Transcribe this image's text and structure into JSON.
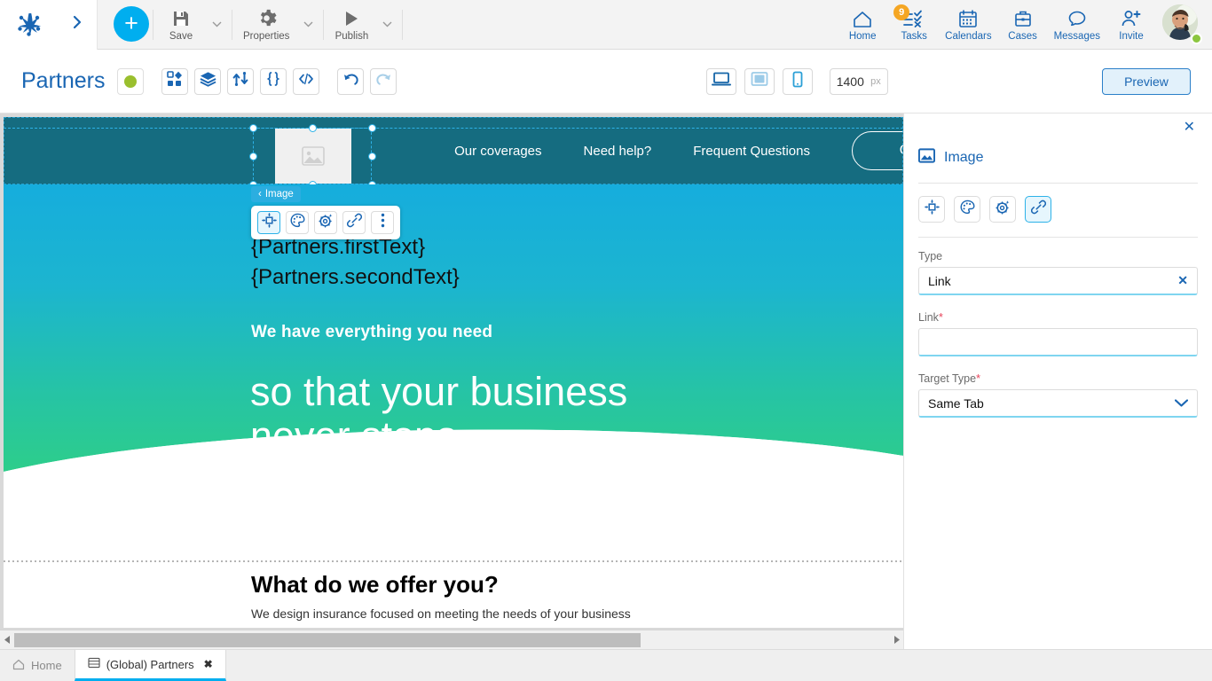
{
  "topbar": {
    "logo_icon": "anchor-logo-icon",
    "expand_icon": "chevron-right-icon",
    "add_button": "+",
    "tools": [
      {
        "label": "Save",
        "icon": "save-disk-icon"
      },
      {
        "label": "Properties",
        "icon": "gear-icon"
      },
      {
        "label": "Publish",
        "icon": "play-triangle-icon"
      }
    ],
    "nav": [
      {
        "label": "Home",
        "icon": "home-icon",
        "badge": ""
      },
      {
        "label": "Tasks",
        "icon": "tasks-checklist-icon",
        "badge": "9"
      },
      {
        "label": "Calendars",
        "icon": "calendar-icon",
        "badge": ""
      },
      {
        "label": "Cases",
        "icon": "briefcase-icon",
        "badge": ""
      },
      {
        "label": "Messages",
        "icon": "speech-bubble-icon",
        "badge": ""
      },
      {
        "label": "Invite",
        "icon": "person-add-icon",
        "badge": ""
      }
    ],
    "avatar_status_color": "#8CC63F"
  },
  "subbar": {
    "page_title": "Partners",
    "status_color": "#9ABF2E",
    "tools": [
      {
        "name": "components-icon"
      },
      {
        "name": "layers-icon"
      },
      {
        "name": "data-flow-icon"
      },
      {
        "name": "curly-braces-icon"
      },
      {
        "name": "code-tags-icon"
      }
    ],
    "history": [
      {
        "name": "undo-icon"
      },
      {
        "name": "redo-icon"
      }
    ],
    "devices": [
      {
        "name": "desktop-icon",
        "active": true
      },
      {
        "name": "tablet-icon",
        "active": false
      },
      {
        "name": "mobile-icon",
        "active": false
      }
    ],
    "width_value": "1400",
    "width_unit": "px",
    "preview_label": "Preview"
  },
  "canvas": {
    "site_nav": {
      "links": [
        "Our coverages",
        "Need help?",
        "Frequent Questions"
      ],
      "pill_label": "Q",
      "bg_color": "#156C80"
    },
    "hero": {
      "kicker": "We have everything you need",
      "title_line1": "so that your business",
      "title_line2": "never stops",
      "gradient_from": "#16ADDD",
      "gradient_to": "#2ECE89"
    },
    "body": {
      "token_line1": "{Partners.firstText}",
      "token_line2": "{Partners.secondText}",
      "offer_title": "What do we offer you?",
      "offer_sub": "We design insurance focused on meeting the needs of your business"
    },
    "selection": {
      "context_label": "Image",
      "back_chevron": "‹",
      "toolbar_buttons": [
        {
          "name": "move-resize-icon",
          "active": true
        },
        {
          "name": "palette-icon",
          "active": false
        },
        {
          "name": "gear-sparkle-icon",
          "active": false
        },
        {
          "name": "link-chain-icon",
          "active": false
        },
        {
          "name": "more-vertical-icon",
          "active": false
        }
      ]
    }
  },
  "panel": {
    "close_label": "✕",
    "title": "Image",
    "title_icon": "image-icon",
    "tabs": [
      {
        "name": "move-resize-icon",
        "active": false
      },
      {
        "name": "palette-icon",
        "active": false
      },
      {
        "name": "gear-sparkle-icon",
        "active": false
      },
      {
        "name": "link-chain-icon",
        "active": true
      }
    ],
    "fields": {
      "type_label": "Type",
      "type_value": "Link",
      "type_clear": "✕",
      "link_label": "Link",
      "link_required": "*",
      "link_value": "",
      "target_label": "Target Type",
      "target_required": "*",
      "target_value": "Same Tab"
    }
  },
  "bottom_tabs": [
    {
      "label": "Home",
      "icon": "home-outline-icon",
      "active": false,
      "closable": false
    },
    {
      "label": "(Global) Partners",
      "icon": "page-icon",
      "active": true,
      "closable": true,
      "close": "✖"
    }
  ]
}
